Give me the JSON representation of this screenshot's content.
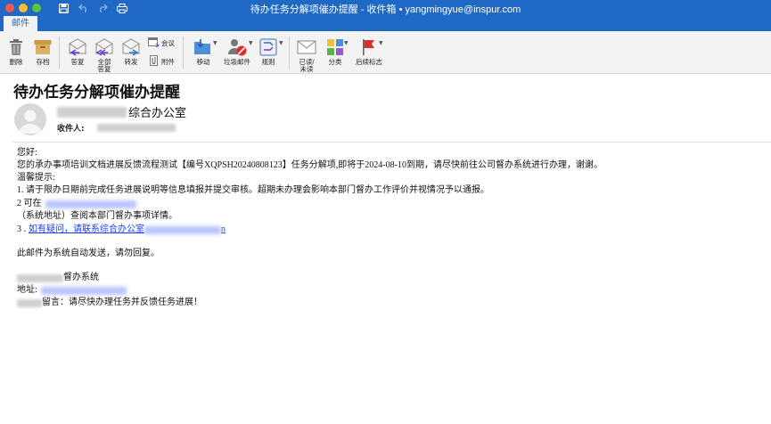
{
  "window": {
    "title": "待办任务分解项催办提醒 - 收件箱 • yangmingyue@inspur.com"
  },
  "ribbon": {
    "active_tab": "邮件",
    "buttons": {
      "delete": "删除",
      "archive": "存档",
      "reply": "答复",
      "reply_all_1": "全部",
      "reply_all_2": "答复",
      "forward": "转发",
      "meeting": "会议",
      "attachment": "附件",
      "move": "移动",
      "junk": "垃圾邮件",
      "rules": "规则",
      "read_unread_1": "已读/",
      "read_unread_2": "未读",
      "categorize": "分类",
      "follow_up": "后续标志"
    }
  },
  "message": {
    "subject": "待办任务分解项催办提醒",
    "sender_suffix": "综合办公室",
    "to_label": "收件人:",
    "body": {
      "greeting": "您好:",
      "line1": "您的承办事项培训文档进展反馈流程测试【编号XQPSH20240808123】任务分解项,即将于2024-08-10到期，请尽快前往公司督办系统进行办理，谢谢。",
      "tips_title": "温馨提示:",
      "tip1": "1. 请于限办日期前完成任务进展说明等信息填报并提交审核。超期未办理会影响本部门督办工作评价并视情况予以通报。",
      "tip2_prefix": "2 可在",
      "tip2_suffix": "（系统地址）查阅本部门督办事项详情。",
      "tip3_prefix": "3 .",
      "tip3_link": "如有疑问，请联系综合办公室",
      "tip3_link_end": "n",
      "auto_notice": "此邮件为系统自动发送，请勿回复。",
      "sig_system_suffix": "督办系统",
      "sig_address_label": "地址:",
      "sig_message_suffix": "留言：请尽快办理任务并反馈任务进展！"
    }
  }
}
